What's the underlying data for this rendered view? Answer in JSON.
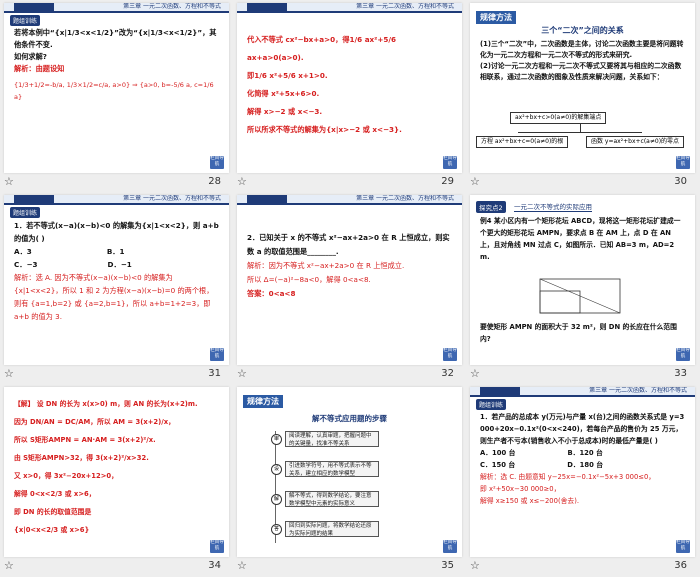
{
  "footer_icon": "star-icon",
  "header_text": "第三章  一元二次函数、方程和不等式",
  "back_label": "栏目导航",
  "slides": [
    {
      "num": "28",
      "tag": "题组训练",
      "lines": [
        "若将本例中“{x|1/3<x<1/2}”改为“{x|1/3<x<1/2}”，其他条件不变.",
        "如何求解?",
        "解析：由题设知",
        "{1/3+1/2=-b/a, 1/3×1/2=c/a, a>0}  ⇒  {a>0, b=-5/6 a, c=1/6 a}"
      ]
    },
    {
      "num": "29",
      "lines": [
        "代入不等式 cx²−bx+a>0，得1/6 ax²+5/6 ax+a>0(a>0).",
        "即1/6 x²+5/6 x+1>0.",
        "化简得 x²+5x+6>0.",
        "解得 x>−2 或 x<−3.",
        "所以所求不等式的解集为{x|x>−2 或 x<−3}."
      ]
    },
    {
      "num": "30",
      "sect": "规律方法",
      "title": "三个“二次”之间的关系",
      "lines": [
        "(1)三个“二次”中，二次函数是主体，讨论二次函数主要是将问题转化为一元二次方程和一元二次不等式的形式来研究.",
        "(2)讨论一元二次方程和一元二次不等式又要将其与相应的二次函数相联系，通过二次函数的图象及性质来解决问题，关系如下："
      ],
      "diagram": {
        "top": "ax²+bx+c>0(a≠0)的解集端点",
        "left": "方程 ax²+bx+c=0(a≠0)的根",
        "right": "函数 y=ax²+bx+c(a≠0)的零点"
      }
    },
    {
      "num": "31",
      "tag": "题组训练",
      "lines": [
        "1．若不等式(x−a)(x−b)<0 的解集为{x|1<x<2}，则 a+b 的值为(     )",
        "A．3                              B．1",
        "C．−3                            D．−1",
        "解析：选 A. 因为不等式(x−a)(x−b)<0 的解集为{x|1<x<2}，所以 1 和 2 为方程(x−a)(x−b)=0 的两个根，则有 {a=1,b=2} 或 {a=2,b=1}，所以 a+b=1+2=3，即 a+b 的值为 3."
      ]
    },
    {
      "num": "32",
      "lines": [
        "2．已知关于 x 的不等式 x²−ax+2a>0 在 R 上恒成立，则实数 a 的取值范围是________.",
        "解析：因为不等式 x²−ax+2a>0 在 R 上恒成立.",
        "所以 Δ=(−a)²−8a<0，解得 0<a<8.",
        "答案：0<a<8"
      ]
    },
    {
      "num": "33",
      "tag": "探究点2",
      "tagtitle": "一元二次不等式的实际应用",
      "lines": [
        "例4  某小区内有一个矩形花坛 ABCD，现将这一矩形花坛扩建成一个更大的矩形花坛 AMPN，要求点 B 在 AM 上，点 D 在 AN 上，且对角线 MN 过点 C，如图所示．已知 AB=3 m，AD=2 m.",
        "要使矩形 AMPN 的面积大于 32 m²，则 DN 的长应在什么范围内?"
      ]
    },
    {
      "num": "34",
      "lines": [
        "【解】  设 DN 的长为 x(x>0) m，则 AN 的长为(x+2)m.",
        "因为 DN/AN = DC/AM，所以 AM = 3(x+2)/x，",
        "所以 S矩形AMPN = AN·AM = 3(x+2)²/x.",
        "由 S矩形AMPN>32，得 3(x+2)²/x>32.",
        "又 x>0，得 3x²−20x+12>0，",
        "解得 0<x<2/3 或 x>6，",
        "即 DN 的长的取值范围是",
        "{x|0<x<2/3 或 x>6}"
      ]
    },
    {
      "num": "35",
      "sect": "规律方法",
      "title": "解不等式应用题的步骤",
      "steps": [
        "阅读理解，认真审题，把握问题中的关键量，找准不等关系",
        "引进数学符号，用不等式表示不等关系，建立相应的数学模型",
        "解不等式，得到数学结论，要注意数学模型中元素的实际意义",
        "回归到实际问题，将数学结论还原为实际问题的结果"
      ],
      "step_labels": [
        "审",
        "设",
        "解",
        "答"
      ]
    },
    {
      "num": "36",
      "tag": "题组训练",
      "lines": [
        "1．若产品的总成本 y(万元)与产量 x(台)之间的函数关系式是 y=3 000+20x−0.1x²(0<x<240)，若每台产品的售价为 25 万元，则生产者不亏本(销售收入不小于总成本)时的最低产量是(     )",
        "A．100 台                      B．120 台",
        "C．150 台                      D．180 台",
        "解析：选 C. 由题意知 y−25x=−0.1x²−5x+3 000≤0，",
        "即 x²+50x−30 000≥0，",
        "解得 x≥150 或 x≤−200(舍去)."
      ]
    }
  ]
}
